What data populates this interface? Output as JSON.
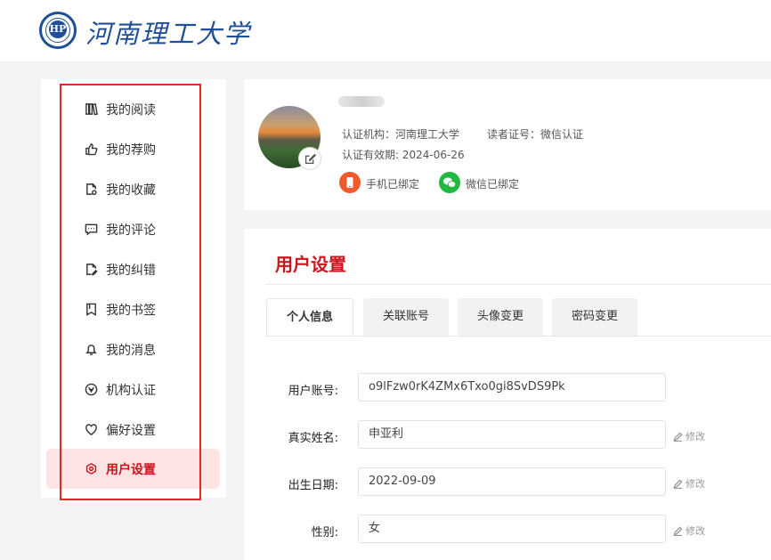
{
  "header": {
    "logo_text": "河南理工大学",
    "logo_seal_glyph": "HP"
  },
  "sidebar": {
    "items": [
      {
        "label": "我的阅读",
        "icon": "book-icon"
      },
      {
        "label": "我的荐购",
        "icon": "thumbs-up-icon"
      },
      {
        "label": "我的收藏",
        "icon": "favorite-doc-icon"
      },
      {
        "label": "我的评论",
        "icon": "comment-icon"
      },
      {
        "label": "我的纠错",
        "icon": "edit-doc-icon"
      },
      {
        "label": "我的书签",
        "icon": "bookmark-icon"
      },
      {
        "label": "我的消息",
        "icon": "bell-icon"
      },
      {
        "label": "机构认证",
        "icon": "verify-icon"
      },
      {
        "label": "偏好设置",
        "icon": "heart-icon"
      },
      {
        "label": "用户设置",
        "icon": "settings-icon",
        "active": true
      }
    ],
    "active_color": "#c8161d"
  },
  "profile": {
    "institution": "认证机构：河南理工大学",
    "reader_id": "读者证号：微信认证",
    "validity": "认证有效期: 2024-06-26",
    "phone_bound": "手机已绑定",
    "wechat_bound": "微信已绑定"
  },
  "settings": {
    "title": "用户设置",
    "tabs": [
      "个人信息",
      "关联账号",
      "头像变更",
      "密码变更"
    ],
    "active_tab": 0,
    "fields": [
      {
        "label": "用户账号:",
        "value": "o9lFzw0rK4ZMx6Txo0gi8SvDS9Pk",
        "editable": false
      },
      {
        "label": "真实姓名:",
        "value": "申亚利",
        "editable": true
      },
      {
        "label": "出生日期:",
        "value": "2022-09-09",
        "editable": true
      },
      {
        "label": "性别:",
        "value": "女",
        "editable": true
      }
    ],
    "edit_label": "修改"
  },
  "colors": {
    "brand_blue": "#1f4f96",
    "accent_red": "#c8161d",
    "phone_orange": "#f15a2b",
    "wechat_green": "#1fb840"
  }
}
